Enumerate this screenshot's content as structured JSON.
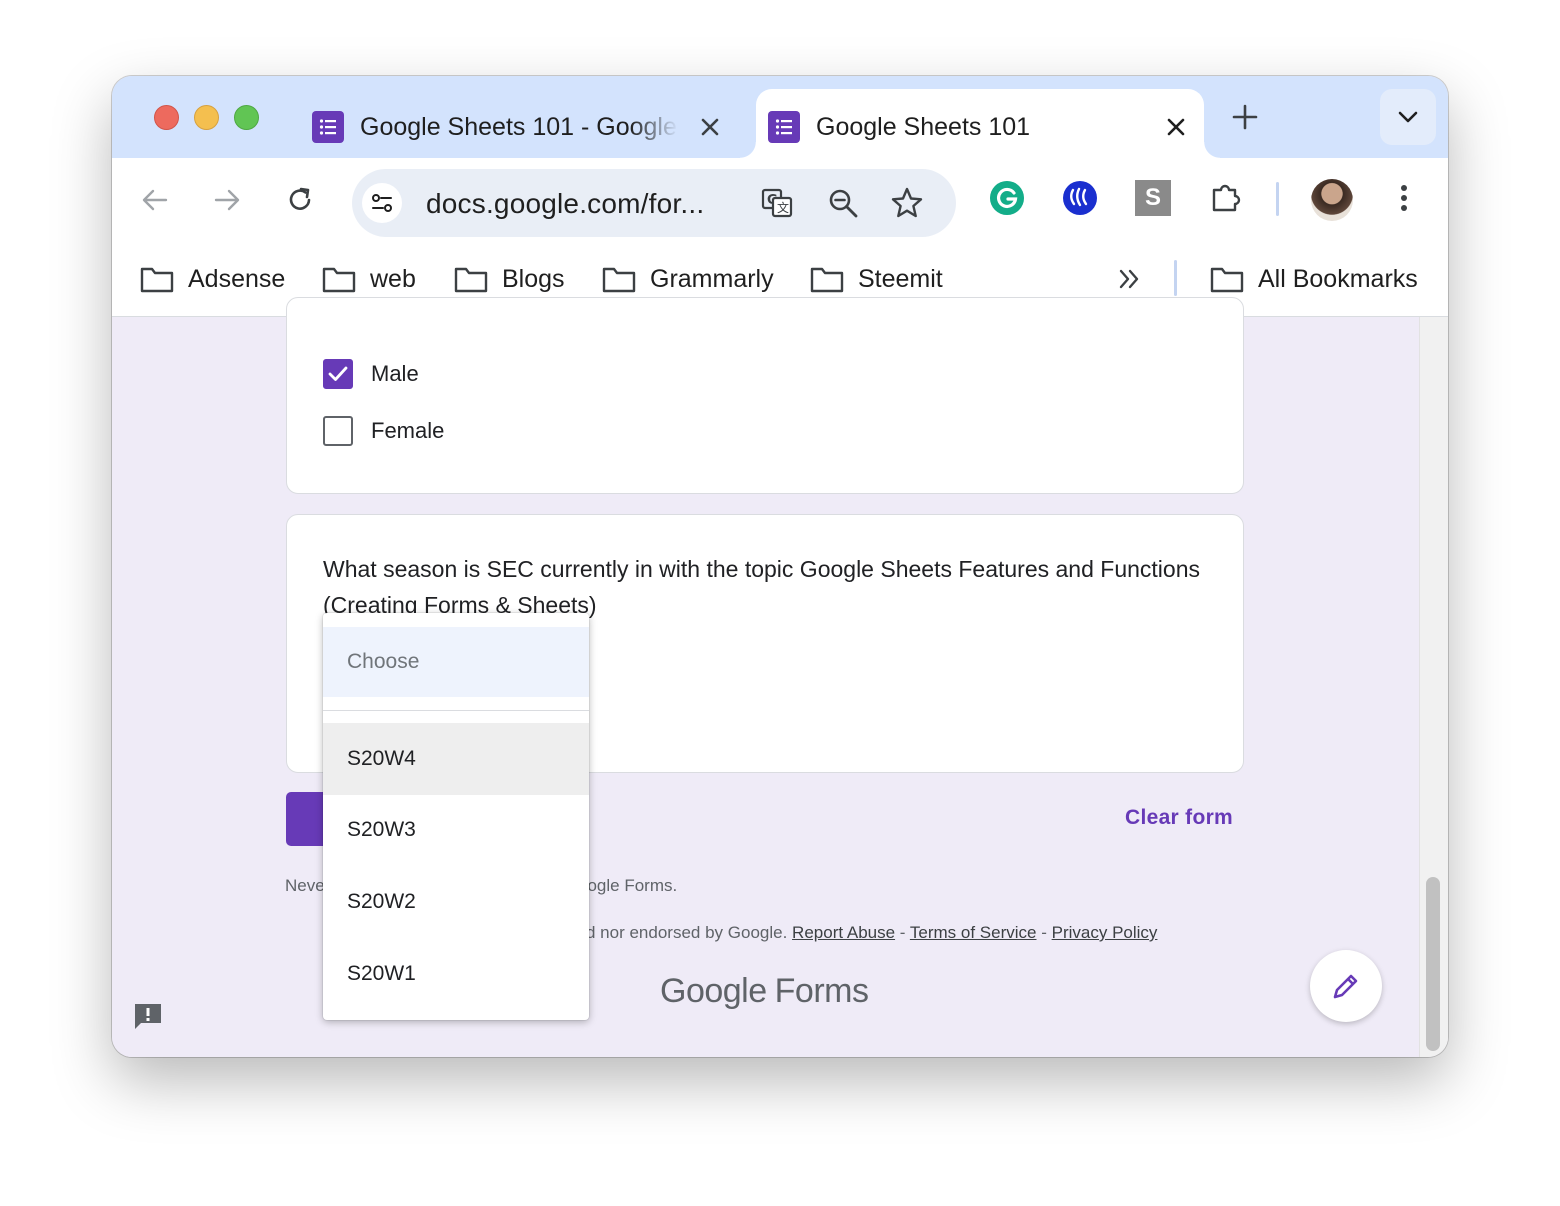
{
  "browser": {
    "tabs": [
      {
        "title": "Google Sheets 101 - Google",
        "active": false
      },
      {
        "title": "Google Sheets 101",
        "active": true
      }
    ],
    "url": "docs.google.com/for...",
    "bookmarks": [
      "Adsense",
      "web",
      "Blogs",
      "Grammarly",
      "Steemit"
    ],
    "all_bookmarks_label": "All Bookmarks",
    "extension_s_label": "S"
  },
  "form": {
    "gender_options": [
      {
        "label": "Male",
        "checked": true
      },
      {
        "label": "Female",
        "checked": false
      }
    ],
    "question": "What season is SEC currently in with the topic Google Sheets Features and Functions (Creating Forms & Sheets)",
    "clear_label": "Clear form",
    "footer_line1_left": "Neve",
    "footer_line1_right": "oogle Forms.",
    "footer_line2_text": "d nor endorsed by Google.",
    "footer_links": [
      "Report Abuse",
      "Terms of Service",
      "Privacy Policy"
    ],
    "footer_sep": "-",
    "logo_google": "Google",
    "logo_forms": "Forms"
  },
  "dropdown": {
    "placeholder": "Choose",
    "options": [
      "S20W4",
      "S20W3",
      "S20W2",
      "S20W1"
    ],
    "hovered_index": 0
  },
  "colors": {
    "accent": "#673ab7",
    "tabstrip": "#d3e3fd",
    "page_bg": "#efebf7"
  }
}
